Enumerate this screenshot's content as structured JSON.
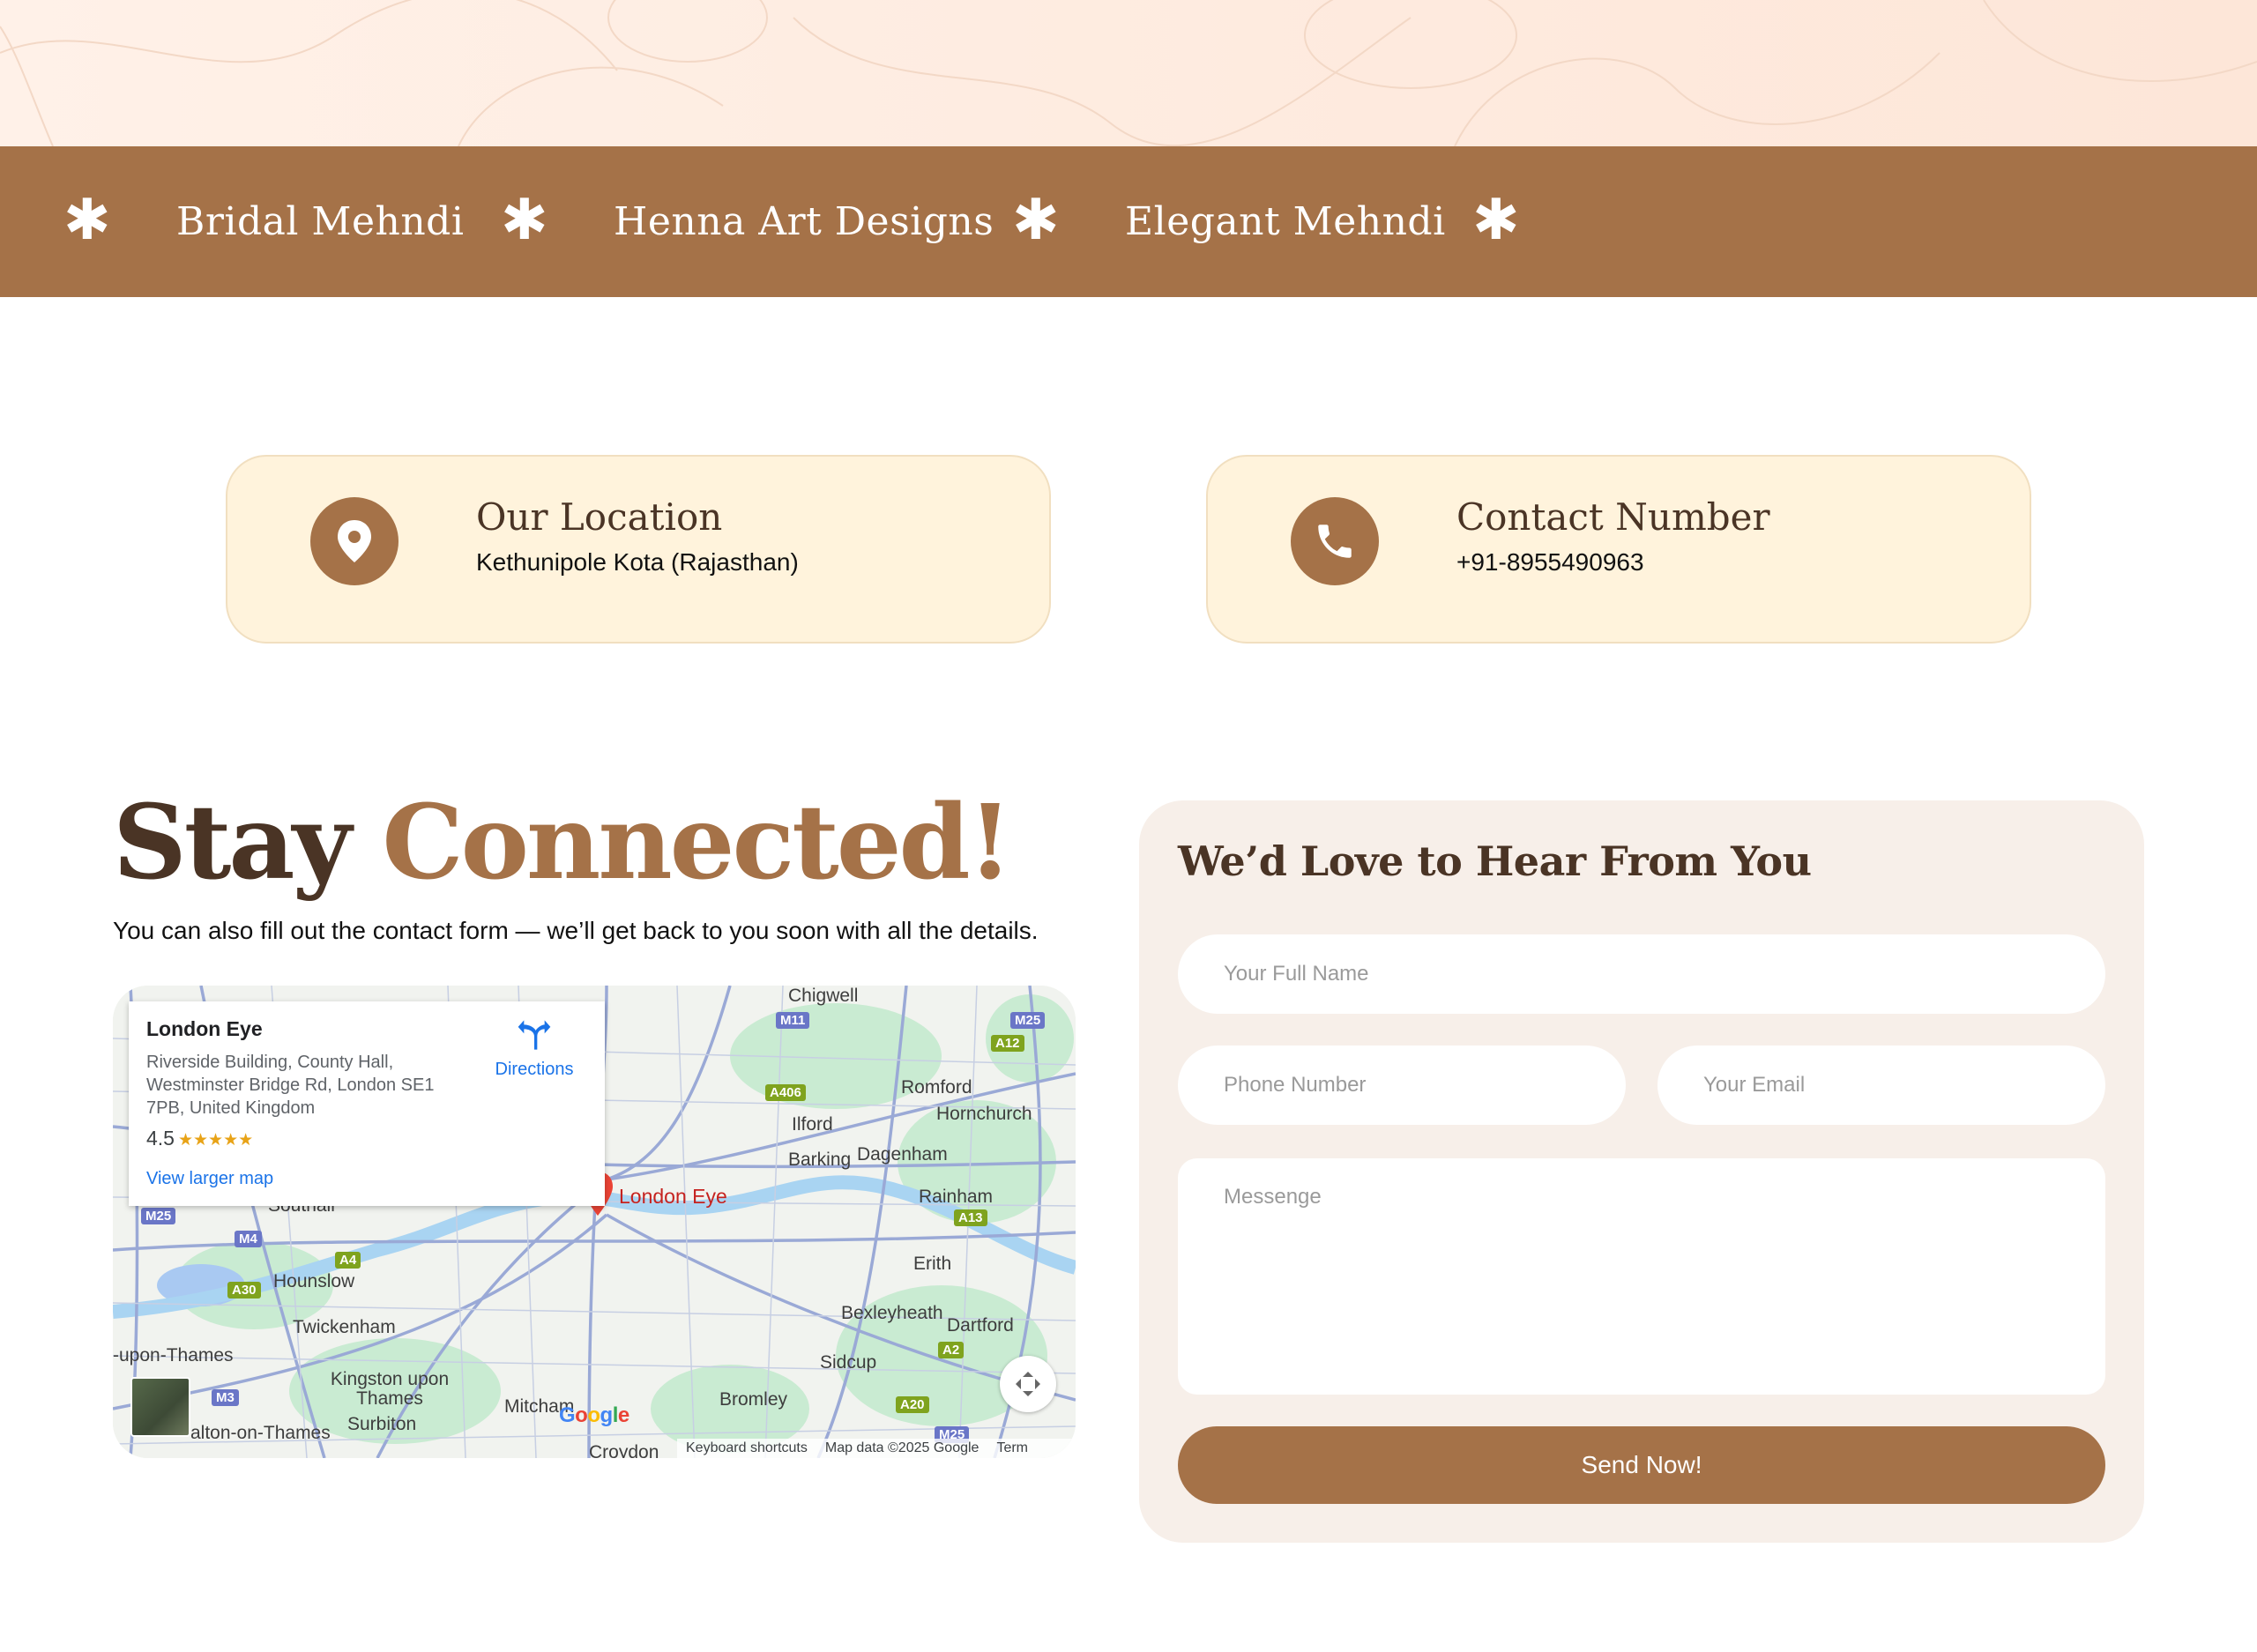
{
  "marquee": {
    "items": [
      "Bridal Mehndi",
      "Henna Art Designs",
      "Elegant Mehndi"
    ],
    "separator_icon": "star-icon"
  },
  "location_card": {
    "icon": "map-pin-icon",
    "title": "Our Location",
    "text": "Kethunipole Kota (Rajasthan)"
  },
  "contact_card": {
    "icon": "phone-icon",
    "title": "Contact Number",
    "text": "+91-8955490963"
  },
  "stay": {
    "heading_plain": "Stay ",
    "heading_accent": "Connected!",
    "subtitle": "You can also fill out the contact form — we’ll get back to you soon with all the details."
  },
  "map": {
    "place_name": "London Eye",
    "address": "Riverside Building, County Hall, Westminster Bridge Rd, London SE1 7PB, United Kingdom",
    "rating": "4.5",
    "stars": "★★★★★",
    "directions_label": "Directions",
    "view_larger_label": "View larger map",
    "pin_label": "London Eye",
    "google_logo": "Google",
    "footer": {
      "shortcuts": "Keyboard shortcuts",
      "data": "Map data ©2025 Google",
      "terms": "Term"
    },
    "places": [
      "Chigwell",
      "Romford",
      "Hornchurch",
      "Ilford",
      "Barking",
      "Dagenham",
      "Rainham",
      "Erith",
      "Bexleyheath",
      "Dartford",
      "Sidcup",
      "Bromley",
      "Mitcham",
      "Croydon",
      "Hounslow",
      "Twickenham",
      "-upon-Thames",
      "Kingston upon Thames",
      "Surbiton",
      "alton-on-Thames",
      "Southall"
    ],
    "roads": [
      "M11",
      "M25",
      "A12",
      "A406",
      "A13",
      "M25",
      "M4",
      "A4",
      "A30",
      "A2",
      "M3",
      "A20",
      "M25"
    ]
  },
  "form": {
    "title": "We’d Love to Hear From You",
    "name_placeholder": "Your Full Name",
    "phone_placeholder": "Phone Number",
    "email_placeholder": "Your Email",
    "message_placeholder": "Messenge",
    "submit_label": "Send Now!"
  },
  "colors": {
    "brand": "#a57248",
    "heading": "#4a3425",
    "card_bg": "#fff3dc",
    "form_bg": "#f7efe9"
  }
}
